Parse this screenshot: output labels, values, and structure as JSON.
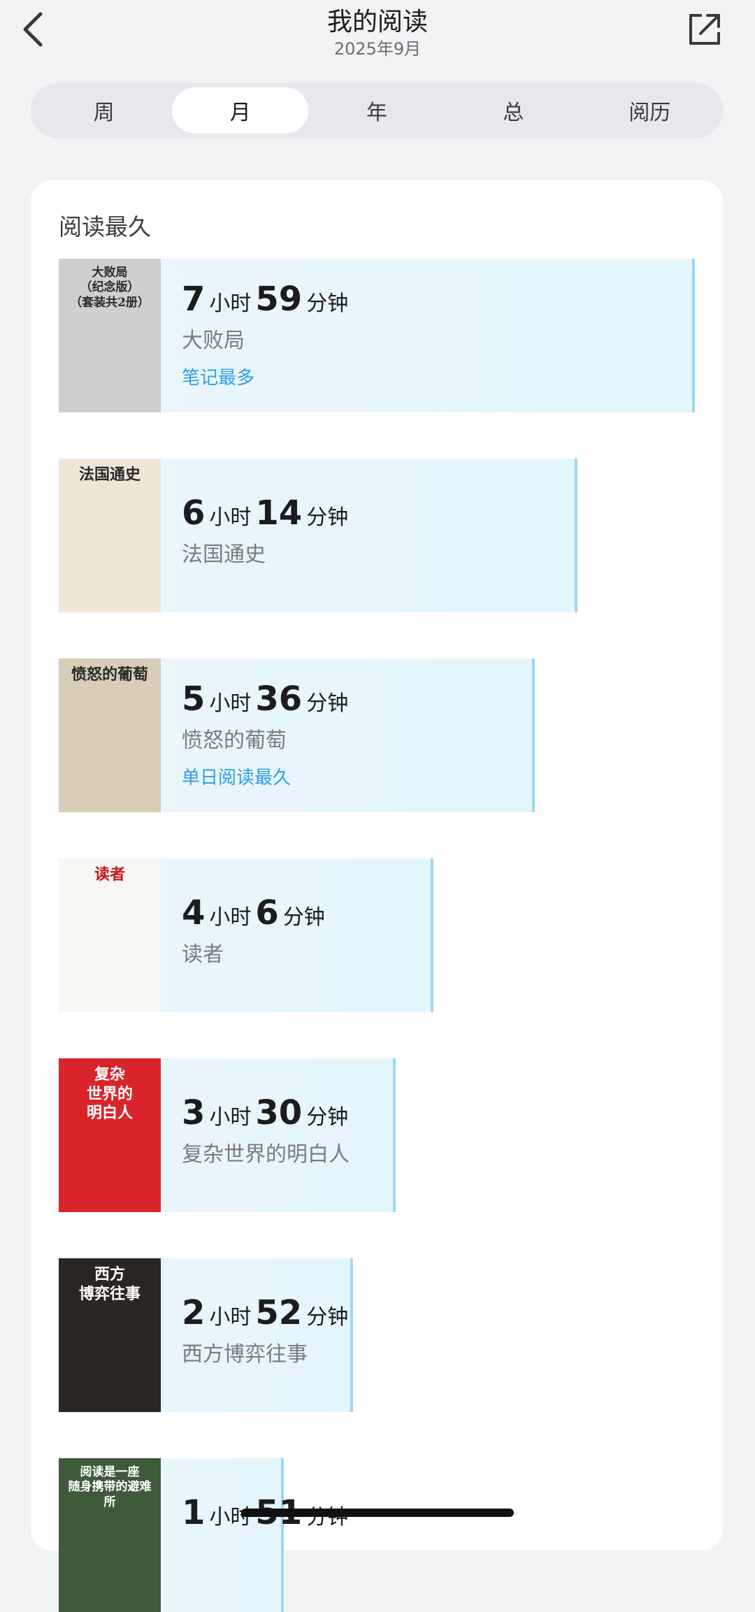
{
  "header": {
    "title": "我的阅读",
    "subtitle": "2025年9月"
  },
  "tabs": [
    {
      "label": "周",
      "active": false
    },
    {
      "label": "月",
      "active": true
    },
    {
      "label": "年",
      "active": false
    },
    {
      "label": "总",
      "active": false
    },
    {
      "label": "阅历",
      "active": false
    }
  ],
  "section_title": "阅读最久",
  "books": [
    {
      "hours": "7",
      "minutes": "59",
      "hour_unit": "小时",
      "minute_unit": "分钟",
      "name": "大败局",
      "tag": "笔记最多",
      "cover_text": "大败局\n（纪念版）\n（套装共2册）",
      "cover_color": "#cfcfcf"
    },
    {
      "hours": "6",
      "minutes": "14",
      "hour_unit": "小时",
      "minute_unit": "分钟",
      "name": "法国通史",
      "tag": "",
      "cover_text": "法国通史",
      "cover_color": "#efe6d6"
    },
    {
      "hours": "5",
      "minutes": "36",
      "hour_unit": "小时",
      "minute_unit": "分钟",
      "name": "愤怒的葡萄",
      "tag": "单日阅读最久",
      "cover_text": "愤怒的葡萄",
      "cover_color": "#d7cdb8"
    },
    {
      "hours": "4",
      "minutes": "6",
      "hour_unit": "小时",
      "minute_unit": "分钟",
      "name": "读者",
      "tag": "",
      "cover_text": "读者",
      "cover_color": "#f7f7f4"
    },
    {
      "hours": "3",
      "minutes": "30",
      "hour_unit": "小时",
      "minute_unit": "分钟",
      "name": "复杂世界的明白人",
      "tag": "",
      "cover_text": "复杂\n世界的\n明白人",
      "cover_color": "#d9242b"
    },
    {
      "hours": "2",
      "minutes": "52",
      "hour_unit": "小时",
      "minute_unit": "分钟",
      "name": "西方博弈往事",
      "tag": "",
      "cover_text": "西方\n博弈往事",
      "cover_color": "#2b2622"
    },
    {
      "hours": "1",
      "minutes": "51",
      "hour_unit": "小时",
      "minute_unit": "分钟",
      "name": "",
      "tag": "",
      "cover_text": "阅读是一座\n随身携带的避难所",
      "cover_color": "#3e5a3a"
    }
  ],
  "reading_share": [
    1.0,
    0.78,
    0.7,
    0.51,
    0.44,
    0.36,
    0.23
  ],
  "colors": {
    "accent": "#2f9ee0",
    "bar_fill": "#e6f6fd",
    "bar_edge": "#9fd6f2"
  }
}
